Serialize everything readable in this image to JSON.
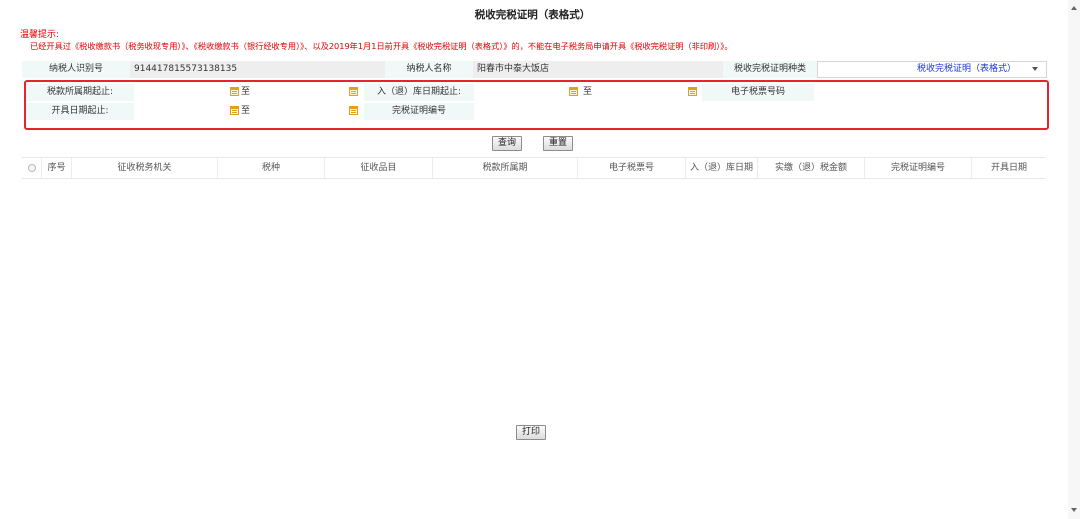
{
  "page": {
    "title": "税收完税证明（表格式）",
    "tip_head": "温馨提示:",
    "tip_body": "已经开具过《税收缴款书（税务收现专用）》、《税收缴款书（银行经收专用）》、以及2019年1月1日前开具《税收完税证明（表格式）》的，不能在电子税务局申请开具《税收完税证明（非印刷）》。"
  },
  "form": {
    "taxpayer_id_label": "纳税人识别号",
    "taxpayer_id_value": "914417815573138135",
    "taxpayer_name_label": "纳税人名称",
    "taxpayer_name_value": "阳春市中泰大饭店",
    "cert_type_label": "税收完税证明种类",
    "cert_type_value": "税收完税证明（表格式）",
    "tax_period_label": "税款所属期起止:",
    "to_text": "至",
    "stock_date_label": "入（退）库日期起止:",
    "e_ticket_label": "电子税票号码",
    "issue_date_label": "开具日期起止:",
    "cert_no_label": "完税证明编号"
  },
  "buttons": {
    "query": "查询",
    "reset": "重置",
    "print": "打印"
  },
  "table": {
    "columns": [
      "序号",
      "征收税务机关",
      "税种",
      "征收品目",
      "税款所属期",
      "电子税票号",
      "入（退）库日期",
      "实缴（退）税金额",
      "完税证明编号",
      "开具日期"
    ]
  },
  "colors": {
    "tip": "#e00000",
    "highlight_frame": "#e4242e",
    "label_bg": "#f1f9f8",
    "value_bg": "#eeeeee",
    "link_blue": "#1a35d8",
    "calendar_icon": "#e3a11a"
  }
}
